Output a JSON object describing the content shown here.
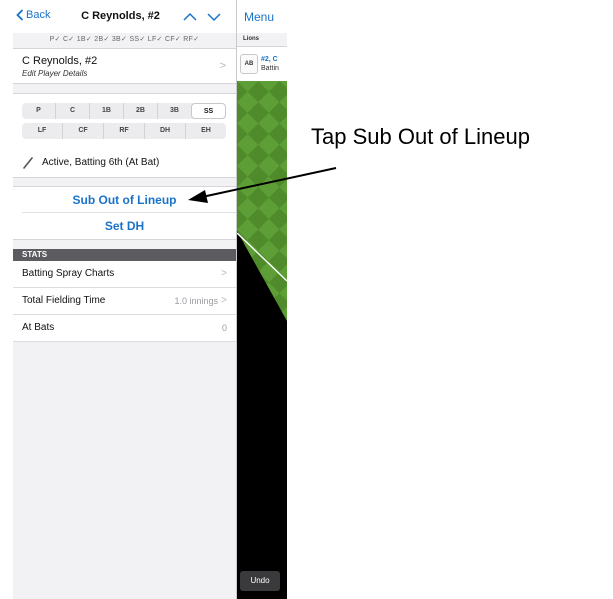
{
  "nav": {
    "back_label": "Back",
    "title": "C Reynolds, #2"
  },
  "position_checks": "P✓ C✓ 1B✓ 2B✓ 3B✓ SS✓ LF✓ CF✓ RF✓",
  "player": {
    "name": "C Reynolds, #2",
    "edit_label": "Edit Player Details"
  },
  "positions": {
    "row1": [
      "P",
      "C",
      "1B",
      "2B",
      "3B",
      "SS"
    ],
    "row2": [
      "LF",
      "CF",
      "RF",
      "DH",
      "EH"
    ],
    "selected": "SS"
  },
  "status": "Active, Batting 6th (At Bat)",
  "actions": {
    "sub_out": "Sub Out of Lineup",
    "set_dh": "Set DH"
  },
  "stats": {
    "header": "STATS",
    "rows": [
      {
        "label": "Batting Spray Charts",
        "value": ""
      },
      {
        "label": "Total Fielding Time",
        "value": "1.0 innings"
      },
      {
        "label": "At Bats",
        "value": "0"
      }
    ]
  },
  "game_panel": {
    "menu_label": "Menu",
    "team_label": "Lions",
    "ab_badge": "AB",
    "batter_name": "#2, C",
    "batter_sub": "Battin",
    "undo_label": "Undo"
  },
  "annotation": {
    "callout_text": "Tap Sub Out of Lineup"
  },
  "colors": {
    "accent": "#1a73c9",
    "field_green": "#5a9a32",
    "stats_header": "#5b5b60"
  }
}
